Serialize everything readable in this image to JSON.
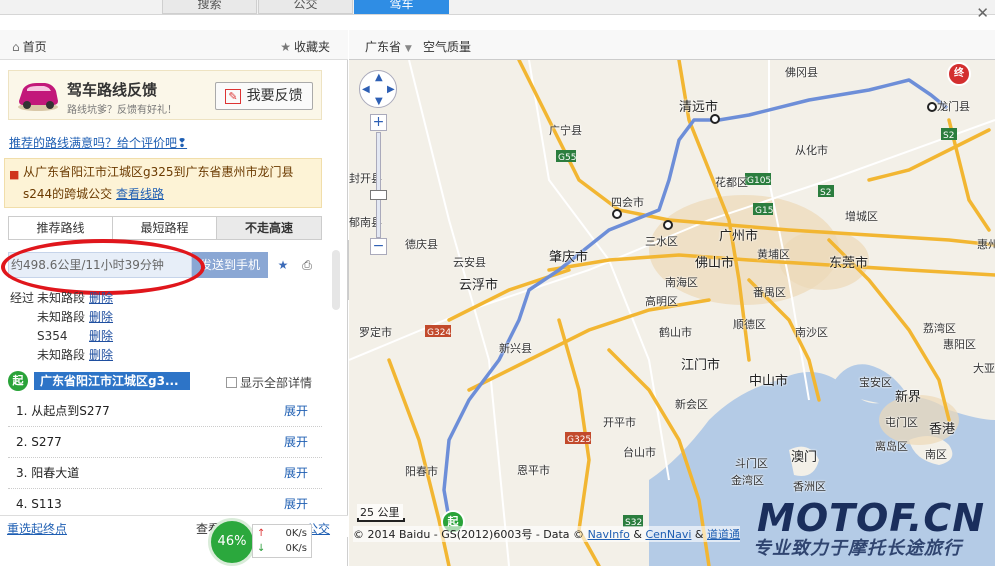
{
  "top_tabs": [
    "搜索",
    "公交",
    "驾车"
  ],
  "left_panel": {
    "home": "首页",
    "favorites": "收藏夹",
    "feedback": {
      "title": "驾车路线反馈",
      "subtitle": "路线坑爹？反馈有好礼！",
      "button": "我要反馈"
    },
    "ask": "推荐的路线满意吗？给个评价吧",
    "notice": {
      "text": "从广东省阳江市江城区g325到广东省惠州市龙门县s244的跨城公交",
      "link": "查看线路"
    },
    "route_tabs": [
      "推荐路线",
      "最短路程",
      "不走高速"
    ],
    "summary": "约498.6公里/11小时39分钟",
    "send": "发送到手机",
    "via": {
      "label": "经过",
      "delete": "删除",
      "items": [
        "未知路段",
        "未知路段",
        "S354",
        "未知路段"
      ]
    },
    "start": {
      "badge": "起",
      "name": "广东省阳江市江城区g3...",
      "show_all": "显示全部详情"
    },
    "steps": [
      {
        "label": "1. 从起点到S277",
        "action": "展开"
      },
      {
        "label": "2. S277",
        "action": "展开"
      },
      {
        "label": "3. 阳春大道",
        "action": "展开"
      },
      {
        "label": "4. S113",
        "action": "展开"
      }
    ],
    "bottom": {
      "reselect": "重选起终点",
      "bus_prefix": "查看",
      "bus_link": "公交"
    },
    "speed": {
      "percent": "46%",
      "up": "0K/s",
      "down": "0K/s"
    }
  },
  "map": {
    "province": "广东省",
    "air_quality": "空气质量",
    "scale_label": "25 公里",
    "copyright": "© 2014 Baidu - GS(2012)6003号 - Data ©",
    "links": [
      "NavInfo",
      "CenNavi",
      "道道通"
    ],
    "end_badge": "终",
    "start_badge": "起",
    "cities": [
      {
        "name": "清远市",
        "big": true
      },
      {
        "name": "广州市",
        "big": true
      },
      {
        "name": "佛山市",
        "big": true
      },
      {
        "name": "东莞市",
        "big": true
      },
      {
        "name": "肇庆市",
        "big": true
      },
      {
        "name": "云浮市",
        "big": true
      },
      {
        "name": "江门市",
        "big": true
      },
      {
        "name": "中山市",
        "big": true
      },
      {
        "name": "新界",
        "big": true
      },
      {
        "name": "香港",
        "big": true
      },
      {
        "name": "澳门",
        "big": true
      },
      {
        "name": "四会市",
        "big": false
      },
      {
        "name": "三水区",
        "big": false
      },
      {
        "name": "花都区",
        "big": false
      },
      {
        "name": "从化市",
        "big": false
      },
      {
        "name": "增城区",
        "big": false
      },
      {
        "name": "番禺区",
        "big": false
      },
      {
        "name": "南沙区",
        "big": false
      },
      {
        "name": "顺德区",
        "big": false
      },
      {
        "name": "鹤山市",
        "big": false
      },
      {
        "name": "高明区",
        "big": false
      },
      {
        "name": "开平市",
        "big": false
      },
      {
        "name": "台山市",
        "big": false
      },
      {
        "name": "恩平市",
        "big": false
      },
      {
        "name": "新会区",
        "big": false
      },
      {
        "name": "阳春市",
        "big": false
      },
      {
        "name": "罗定市",
        "big": false
      },
      {
        "name": "新兴县",
        "big": false
      },
      {
        "name": "云安县",
        "big": false
      },
      {
        "name": "德庆县",
        "big": false
      },
      {
        "name": "郁南县",
        "big": false
      },
      {
        "name": "封开县",
        "big": false
      },
      {
        "name": "广宁县",
        "big": false
      },
      {
        "name": "佛冈县",
        "big": false
      },
      {
        "name": "龙门县",
        "big": false
      },
      {
        "name": "惠州",
        "big": false
      },
      {
        "name": "宝安区",
        "big": false
      },
      {
        "name": "屯门区",
        "big": false
      },
      {
        "name": "离岛区",
        "big": false
      },
      {
        "name": "南区",
        "big": false
      },
      {
        "name": "荔湾区",
        "big": false
      },
      {
        "name": "斗门区",
        "big": false
      },
      {
        "name": "金湾区",
        "big": false
      },
      {
        "name": "香洲区",
        "big": false
      },
      {
        "name": "南海区",
        "big": false
      },
      {
        "name": "黄埔区",
        "big": false
      },
      {
        "name": "惠阳区",
        "big": false
      },
      {
        "name": "大亚湾",
        "big": false
      }
    ],
    "road_labels": [
      "G55",
      "G105",
      "G15",
      "S2",
      "G324",
      "G325",
      "S32",
      "S2"
    ]
  },
  "watermark": {
    "site": "MOTOF.CN",
    "slogan": "专业致力于摩托长途旅行"
  }
}
